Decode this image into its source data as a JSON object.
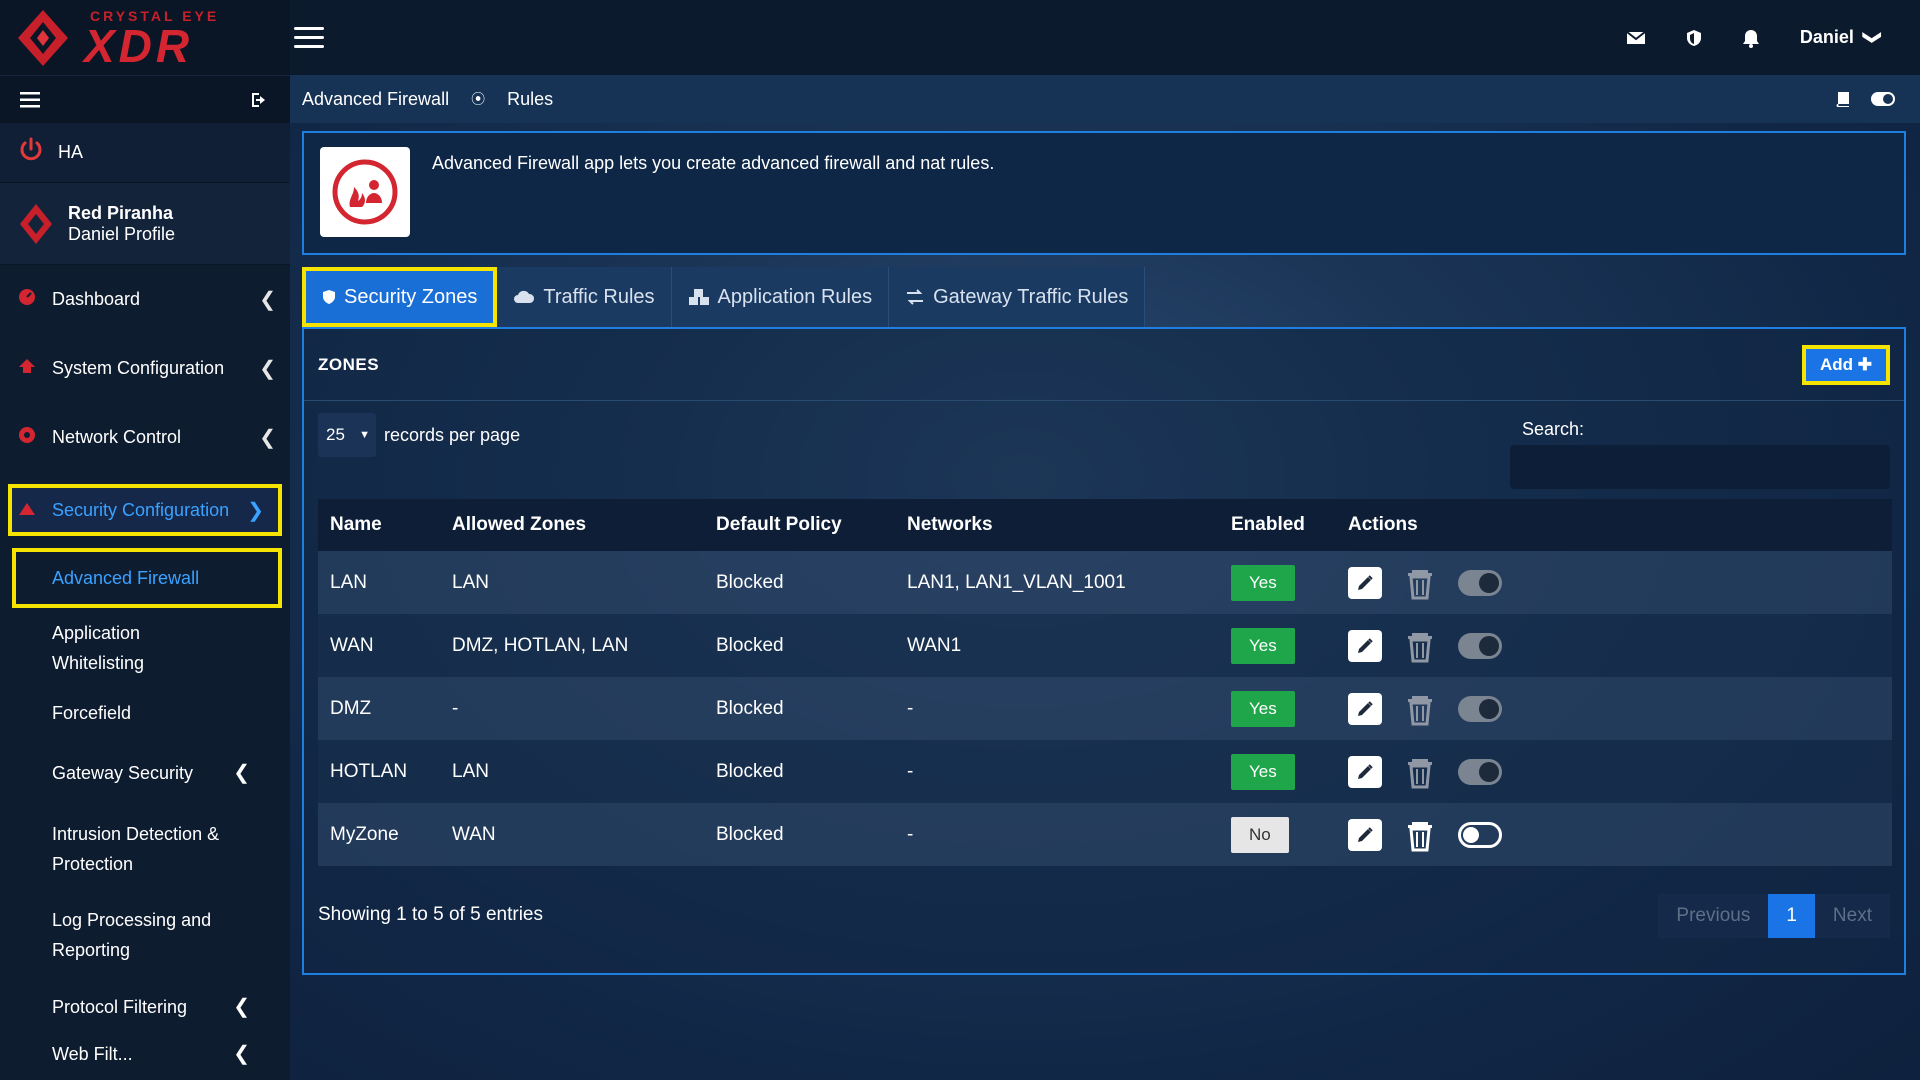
{
  "brand": {
    "top": "CRYSTAL EYE",
    "main": "XDR"
  },
  "user": {
    "name": "Daniel"
  },
  "sidebar": {
    "ha_label": "HA",
    "profile_name": "Red Piranha",
    "profile_sub": "Daniel Profile",
    "items": [
      {
        "label": "Dashboard"
      },
      {
        "label": "System Configuration"
      },
      {
        "label": "Network Control"
      },
      {
        "label": "Security Configuration"
      }
    ],
    "subitems": [
      {
        "label": "Advanced Firewall"
      },
      {
        "label": "Application Whitelisting"
      },
      {
        "label": "Forcefield"
      },
      {
        "label": "Gateway Security"
      },
      {
        "label": "Intrusion Detection & Protection"
      },
      {
        "label": "Log Processing and Reporting"
      },
      {
        "label": "Protocol Filtering"
      },
      {
        "label": "Web Filt..."
      }
    ]
  },
  "breadcrumb": {
    "parent": "Advanced Firewall",
    "current": "Rules"
  },
  "info": {
    "text": "Advanced Firewall app lets you create advanced firewall and nat rules."
  },
  "tabs": [
    {
      "label": "Security Zones"
    },
    {
      "label": "Traffic Rules"
    },
    {
      "label": "Application Rules"
    },
    {
      "label": "Gateway Traffic Rules"
    }
  ],
  "panel": {
    "title": "ZONES",
    "add_label": "Add",
    "length_value": "25",
    "length_label": "records per page",
    "search_label": "Search:",
    "search_value": ""
  },
  "table": {
    "headers": [
      "Name",
      "Allowed Zones",
      "Default Policy",
      "Networks",
      "Enabled",
      "Actions"
    ],
    "rows": [
      {
        "name": "LAN",
        "allowed": "LAN",
        "policy": "Blocked",
        "networks": "LAN1, LAN1_VLAN_1001",
        "enabled": "Yes"
      },
      {
        "name": "WAN",
        "allowed": "DMZ, HOTLAN, LAN",
        "policy": "Blocked",
        "networks": "WAN1",
        "enabled": "Yes"
      },
      {
        "name": "DMZ",
        "allowed": "-",
        "policy": "Blocked",
        "networks": "-",
        "enabled": "Yes"
      },
      {
        "name": "HOTLAN",
        "allowed": "LAN",
        "policy": "Blocked",
        "networks": "-",
        "enabled": "Yes"
      },
      {
        "name": "MyZone",
        "allowed": "WAN",
        "policy": "Blocked",
        "networks": "-",
        "enabled": "No"
      }
    ]
  },
  "footer": {
    "info": "Showing 1 to 5 of 5 entries",
    "prev": "Previous",
    "page": "1",
    "next": "Next"
  },
  "colors": {
    "accent": "#1a74e6",
    "highlight": "#f5e400",
    "brand_red": "#d42631",
    "yes_green": "#1fa64a"
  }
}
